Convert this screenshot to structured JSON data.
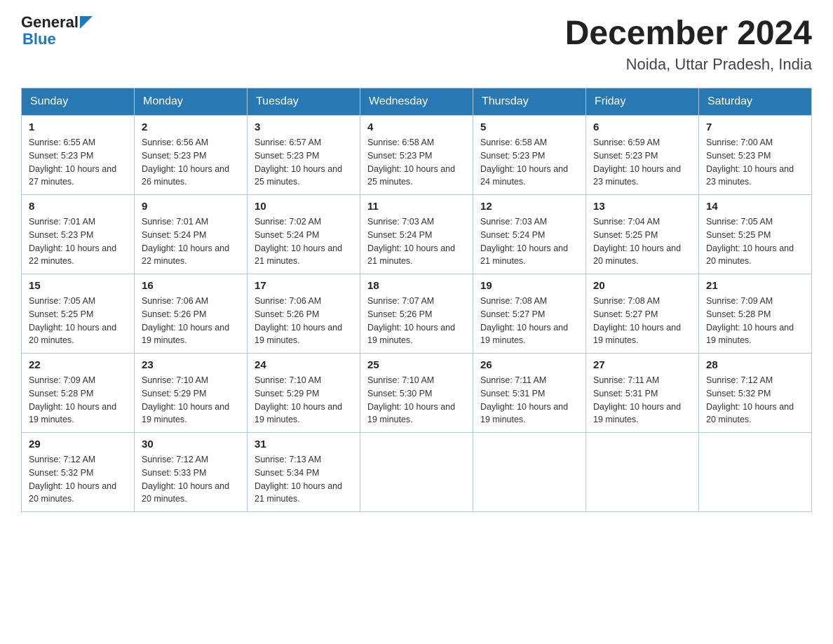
{
  "header": {
    "logo": {
      "general": "General",
      "blue": "Blue"
    },
    "title": "December 2024",
    "subtitle": "Noida, Uttar Pradesh, India"
  },
  "days_of_week": [
    "Sunday",
    "Monday",
    "Tuesday",
    "Wednesday",
    "Thursday",
    "Friday",
    "Saturday"
  ],
  "weeks": [
    [
      {
        "day": "1",
        "sunrise": "Sunrise: 6:55 AM",
        "sunset": "Sunset: 5:23 PM",
        "daylight": "Daylight: 10 hours and 27 minutes."
      },
      {
        "day": "2",
        "sunrise": "Sunrise: 6:56 AM",
        "sunset": "Sunset: 5:23 PM",
        "daylight": "Daylight: 10 hours and 26 minutes."
      },
      {
        "day": "3",
        "sunrise": "Sunrise: 6:57 AM",
        "sunset": "Sunset: 5:23 PM",
        "daylight": "Daylight: 10 hours and 25 minutes."
      },
      {
        "day": "4",
        "sunrise": "Sunrise: 6:58 AM",
        "sunset": "Sunset: 5:23 PM",
        "daylight": "Daylight: 10 hours and 25 minutes."
      },
      {
        "day": "5",
        "sunrise": "Sunrise: 6:58 AM",
        "sunset": "Sunset: 5:23 PM",
        "daylight": "Daylight: 10 hours and 24 minutes."
      },
      {
        "day": "6",
        "sunrise": "Sunrise: 6:59 AM",
        "sunset": "Sunset: 5:23 PM",
        "daylight": "Daylight: 10 hours and 23 minutes."
      },
      {
        "day": "7",
        "sunrise": "Sunrise: 7:00 AM",
        "sunset": "Sunset: 5:23 PM",
        "daylight": "Daylight: 10 hours and 23 minutes."
      }
    ],
    [
      {
        "day": "8",
        "sunrise": "Sunrise: 7:01 AM",
        "sunset": "Sunset: 5:23 PM",
        "daylight": "Daylight: 10 hours and 22 minutes."
      },
      {
        "day": "9",
        "sunrise": "Sunrise: 7:01 AM",
        "sunset": "Sunset: 5:24 PM",
        "daylight": "Daylight: 10 hours and 22 minutes."
      },
      {
        "day": "10",
        "sunrise": "Sunrise: 7:02 AM",
        "sunset": "Sunset: 5:24 PM",
        "daylight": "Daylight: 10 hours and 21 minutes."
      },
      {
        "day": "11",
        "sunrise": "Sunrise: 7:03 AM",
        "sunset": "Sunset: 5:24 PM",
        "daylight": "Daylight: 10 hours and 21 minutes."
      },
      {
        "day": "12",
        "sunrise": "Sunrise: 7:03 AM",
        "sunset": "Sunset: 5:24 PM",
        "daylight": "Daylight: 10 hours and 21 minutes."
      },
      {
        "day": "13",
        "sunrise": "Sunrise: 7:04 AM",
        "sunset": "Sunset: 5:25 PM",
        "daylight": "Daylight: 10 hours and 20 minutes."
      },
      {
        "day": "14",
        "sunrise": "Sunrise: 7:05 AM",
        "sunset": "Sunset: 5:25 PM",
        "daylight": "Daylight: 10 hours and 20 minutes."
      }
    ],
    [
      {
        "day": "15",
        "sunrise": "Sunrise: 7:05 AM",
        "sunset": "Sunset: 5:25 PM",
        "daylight": "Daylight: 10 hours and 20 minutes."
      },
      {
        "day": "16",
        "sunrise": "Sunrise: 7:06 AM",
        "sunset": "Sunset: 5:26 PM",
        "daylight": "Daylight: 10 hours and 19 minutes."
      },
      {
        "day": "17",
        "sunrise": "Sunrise: 7:06 AM",
        "sunset": "Sunset: 5:26 PM",
        "daylight": "Daylight: 10 hours and 19 minutes."
      },
      {
        "day": "18",
        "sunrise": "Sunrise: 7:07 AM",
        "sunset": "Sunset: 5:26 PM",
        "daylight": "Daylight: 10 hours and 19 minutes."
      },
      {
        "day": "19",
        "sunrise": "Sunrise: 7:08 AM",
        "sunset": "Sunset: 5:27 PM",
        "daylight": "Daylight: 10 hours and 19 minutes."
      },
      {
        "day": "20",
        "sunrise": "Sunrise: 7:08 AM",
        "sunset": "Sunset: 5:27 PM",
        "daylight": "Daylight: 10 hours and 19 minutes."
      },
      {
        "day": "21",
        "sunrise": "Sunrise: 7:09 AM",
        "sunset": "Sunset: 5:28 PM",
        "daylight": "Daylight: 10 hours and 19 minutes."
      }
    ],
    [
      {
        "day": "22",
        "sunrise": "Sunrise: 7:09 AM",
        "sunset": "Sunset: 5:28 PM",
        "daylight": "Daylight: 10 hours and 19 minutes."
      },
      {
        "day": "23",
        "sunrise": "Sunrise: 7:10 AM",
        "sunset": "Sunset: 5:29 PM",
        "daylight": "Daylight: 10 hours and 19 minutes."
      },
      {
        "day": "24",
        "sunrise": "Sunrise: 7:10 AM",
        "sunset": "Sunset: 5:29 PM",
        "daylight": "Daylight: 10 hours and 19 minutes."
      },
      {
        "day": "25",
        "sunrise": "Sunrise: 7:10 AM",
        "sunset": "Sunset: 5:30 PM",
        "daylight": "Daylight: 10 hours and 19 minutes."
      },
      {
        "day": "26",
        "sunrise": "Sunrise: 7:11 AM",
        "sunset": "Sunset: 5:31 PM",
        "daylight": "Daylight: 10 hours and 19 minutes."
      },
      {
        "day": "27",
        "sunrise": "Sunrise: 7:11 AM",
        "sunset": "Sunset: 5:31 PM",
        "daylight": "Daylight: 10 hours and 19 minutes."
      },
      {
        "day": "28",
        "sunrise": "Sunrise: 7:12 AM",
        "sunset": "Sunset: 5:32 PM",
        "daylight": "Daylight: 10 hours and 20 minutes."
      }
    ],
    [
      {
        "day": "29",
        "sunrise": "Sunrise: 7:12 AM",
        "sunset": "Sunset: 5:32 PM",
        "daylight": "Daylight: 10 hours and 20 minutes."
      },
      {
        "day": "30",
        "sunrise": "Sunrise: 7:12 AM",
        "sunset": "Sunset: 5:33 PM",
        "daylight": "Daylight: 10 hours and 20 minutes."
      },
      {
        "day": "31",
        "sunrise": "Sunrise: 7:13 AM",
        "sunset": "Sunset: 5:34 PM",
        "daylight": "Daylight: 10 hours and 21 minutes."
      },
      null,
      null,
      null,
      null
    ]
  ]
}
